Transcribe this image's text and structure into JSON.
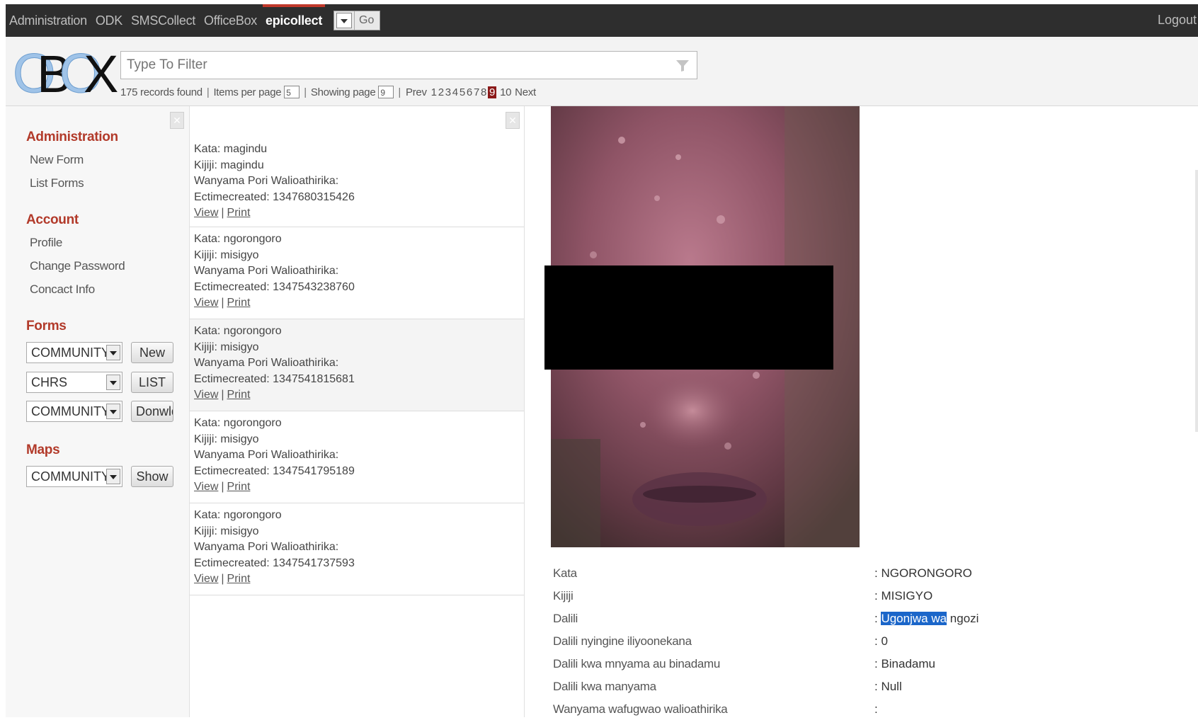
{
  "topnav": {
    "items": [
      "Administration",
      "ODK",
      "SMSCollect",
      "OfficeBox",
      "epicollect"
    ],
    "active": "epicollect",
    "go_label": "Go",
    "logout_label": "Logout"
  },
  "header": {
    "logo_text": "OBOX",
    "filter_placeholder": "Type To Filter",
    "records_found": "175 records found",
    "items_per_page_label": "Items per page",
    "items_per_page_value": "5",
    "showing_page_label": "Showing page",
    "showing_page_value": "9",
    "prev_label": "Prev",
    "pages": [
      "1",
      "2",
      "3",
      "4",
      "5",
      "6",
      "7",
      "8",
      "9",
      "10"
    ],
    "current_page": "9",
    "next_label": "Next"
  },
  "sidebar": {
    "administration": {
      "title": "Administration",
      "links": [
        "New Form",
        "List Forms"
      ]
    },
    "account": {
      "title": "Account",
      "links": [
        "Profile",
        "Change Password",
        "Concact Info"
      ]
    },
    "forms": {
      "title": "Forms",
      "rows": [
        {
          "select": "COMMUNITY",
          "button": "New"
        },
        {
          "select": "CHRS",
          "button": "LIST"
        },
        {
          "select": "COMMUNITY",
          "button": "Donwld"
        }
      ]
    },
    "maps": {
      "title": "Maps",
      "select": "COMMUNITY",
      "button": "Show"
    }
  },
  "records": [
    {
      "kata": "Kata: magindu",
      "kijiji": "Kijiji: magindu",
      "wanyama": "Wanyama Pori Walioathirika:",
      "ect": "Ectimecreated: 1347680315426"
    },
    {
      "kata": "Kata: ngorongoro",
      "kijiji": "Kijiji: misigyo",
      "wanyama": "Wanyama Pori Walioathirika:",
      "ect": "Ectimecreated: 1347543238760"
    },
    {
      "kata": "Kata: ngorongoro",
      "kijiji": "Kijiji: misigyo",
      "wanyama": "Wanyama Pori Walioathirika:",
      "ect": "Ectimecreated: 1347541815681"
    },
    {
      "kata": "Kata: ngorongoro",
      "kijiji": "Kijiji: misigyo",
      "wanyama": "Wanyama Pori Walioathirika:",
      "ect": "Ectimecreated: 1347541795189"
    },
    {
      "kata": "Kata: ngorongoro",
      "kijiji": "Kijiji: misigyo",
      "wanyama": "Wanyama Pori Walioathirika:",
      "ect": "Ectimecreated: 1347541737593"
    }
  ],
  "record_links": {
    "view": "View",
    "print": "Print"
  },
  "details": {
    "rows": [
      {
        "key": "Kata",
        "value": ": NGORONGORO"
      },
      {
        "key": "Kijiji",
        "value": ": MISIGYO"
      },
      {
        "key": "Dalili",
        "value_prefix": ": ",
        "value_highlight": "Ugonjwa wa",
        "value_rest": " ngozi"
      },
      {
        "key": "Dalili nyingine iliyoonekana",
        "value": ": 0"
      },
      {
        "key": "Dalili kwa mnyama au binadamu",
        "value": ": Binadamu"
      },
      {
        "key": "Dalili kwa manyama",
        "value": ": Null"
      },
      {
        "key": "Wanyama wafugwao walioathirika",
        "value": ":"
      }
    ]
  },
  "colors": {
    "topbar": "#2e2e2e",
    "accent": "#b23a2a",
    "current_page": "#8b1a1a",
    "highlight": "#1b66c9"
  }
}
